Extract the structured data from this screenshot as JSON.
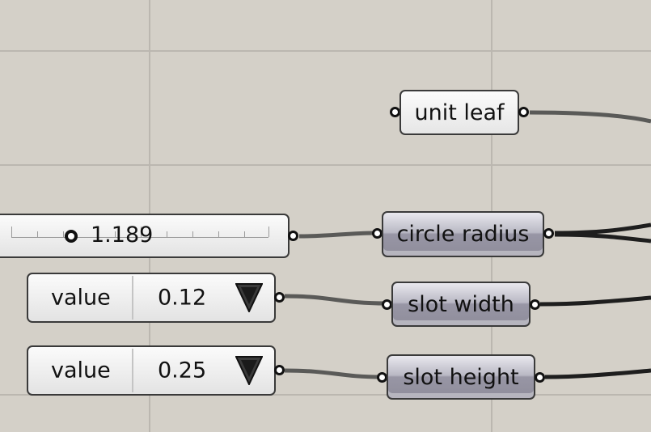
{
  "canvas": {
    "background": "#d4d0c8",
    "grid_color": "#bbb7b0"
  },
  "groups": {
    "unit_leaf": {
      "label": "unit leaf"
    },
    "circle_radius": {
      "label": "circle radius"
    },
    "slot_width": {
      "label": "slot width"
    },
    "slot_height": {
      "label": "slot height"
    }
  },
  "number_slider": {
    "value": "1.189"
  },
  "value_lists": [
    {
      "label": "value",
      "selected": "0.12"
    },
    {
      "label": "value",
      "selected": "0.25"
    }
  ],
  "icons": {
    "dropdown": "dropdown-triangle-icon",
    "port": "port-circle-icon"
  }
}
